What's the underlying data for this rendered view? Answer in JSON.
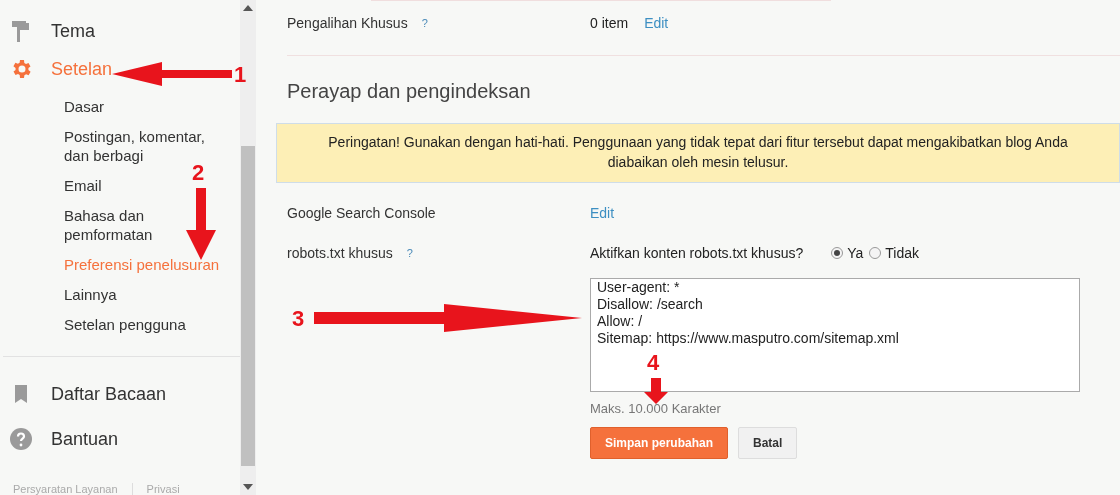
{
  "sidebar": {
    "items": [
      {
        "label": "Tema",
        "selected": false
      },
      {
        "label": "Setelan",
        "selected": true,
        "children": [
          {
            "label": "Dasar",
            "selected": false
          },
          {
            "label": "Postingan, komentar, dan berbagi",
            "selected": false
          },
          {
            "label": "Email",
            "selected": false
          },
          {
            "label": "Bahasa dan pemformatan",
            "selected": false
          },
          {
            "label": "Preferensi penelusuran",
            "selected": true
          },
          {
            "label": "Lainnya",
            "selected": false
          },
          {
            "label": "Setelan pengguna",
            "selected": false
          }
        ]
      }
    ],
    "secondary": [
      {
        "label": "Daftar Bacaan"
      },
      {
        "label": "Bantuan"
      }
    ],
    "footer_links": [
      "Persyaratan Layanan",
      "Privasi"
    ]
  },
  "settings": {
    "top_row": {
      "label": "Pengalihan Khusus",
      "help": "?",
      "value": "0 item",
      "action": "Edit"
    },
    "section_title": "Perayap dan pengindeksan",
    "warning": "Peringatan! Gunakan dengan hati-hati. Penggunaan yang tidak tepat dari fitur tersebut dapat mengakibatkan blog Anda diabaikan oleh mesin telusur.",
    "console_row": {
      "label": "Google Search Console",
      "action": "Edit"
    },
    "robots": {
      "label": "robots.txt khusus",
      "help": "?",
      "question": "Aktifkan konten robots.txt khusus?",
      "options": [
        {
          "label": "Ya",
          "selected": true
        },
        {
          "label": "Tidak",
          "selected": false
        }
      ],
      "content": [
        "User-agent: *",
        "Disallow: /search",
        "Allow: /",
        "Sitemap: https://www.masputro.com/sitemap.xml"
      ],
      "limit": "Maks. 10.000 Karakter",
      "buttons": [
        {
          "label": "Simpan perubahan",
          "kind": "primary"
        },
        {
          "label": "Batal",
          "kind": "secondary"
        }
      ]
    }
  },
  "annotations": [
    {
      "number": "1"
    },
    {
      "number": "2"
    },
    {
      "number": "3"
    },
    {
      "number": "4"
    }
  ]
}
